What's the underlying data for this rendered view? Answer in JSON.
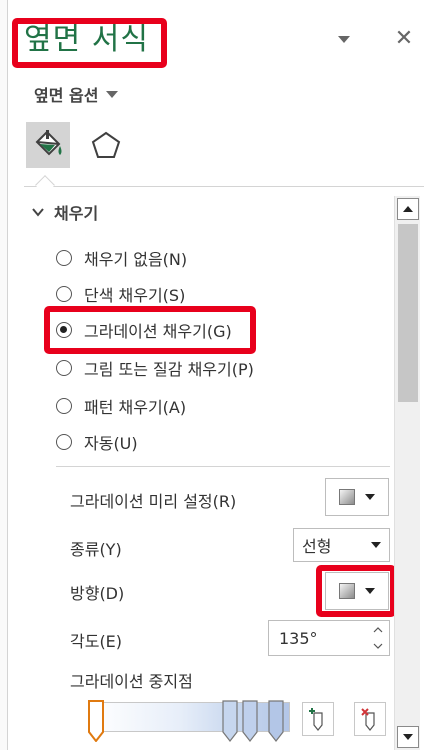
{
  "pane": {
    "title": "옆면 서식",
    "options_label": "옆면 옵션",
    "close_glyph": "✕"
  },
  "tabs": [
    {
      "name": "fill-line",
      "icon": "paint-bucket-icon",
      "active": true
    },
    {
      "name": "effects",
      "icon": "pentagon-icon",
      "active": false
    }
  ],
  "fill_section": {
    "heading": "채우기",
    "options": [
      {
        "label": "채우기 없음(N)",
        "checked": false
      },
      {
        "label": "단색 채우기(S)",
        "checked": false
      },
      {
        "label": "그라데이션 채우기(G)",
        "checked": true
      },
      {
        "label": "그림 또는 질감 채우기(P)",
        "checked": false
      },
      {
        "label": "패턴 채우기(A)",
        "checked": false
      },
      {
        "label": "자동(U)",
        "checked": false
      }
    ]
  },
  "gradient": {
    "preset_label": "그라데이션 미리 설정(R)",
    "type_label": "종류(Y)",
    "type_value": "선형",
    "direction_label": "방향(D)",
    "angle_label": "각도(E)",
    "angle_value": "135°",
    "stops_label": "그라데이션 중지점",
    "stop_colors": [
      "#ffffff",
      "#e7eef9",
      "#c6d6ee",
      "#b3c6e7"
    ]
  },
  "colors": {
    "title_green": "#217346",
    "highlight_red": "#e8001c"
  }
}
